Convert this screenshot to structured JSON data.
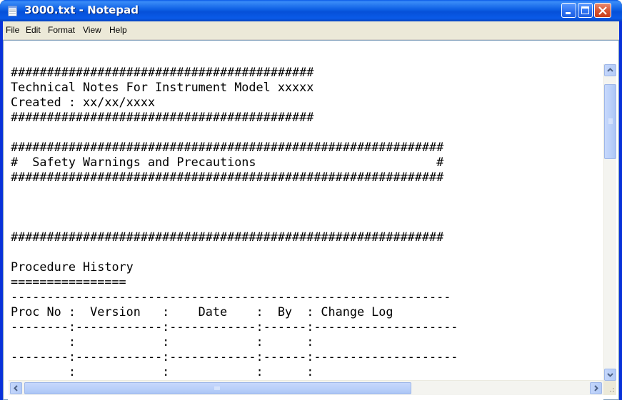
{
  "window": {
    "title": "3000.txt - Notepad"
  },
  "menu": {
    "items": [
      "File",
      "Edit",
      "Format",
      "View",
      "Help"
    ]
  },
  "document": {
    "lines": [
      "##########################################",
      "Technical Notes For Instrument Model xxxxx",
      "Created : xx/xx/xxxx",
      "##########################################",
      "",
      "############################################################",
      "#  Safety Warnings and Precautions                         #",
      "############################################################",
      "",
      "",
      "",
      "############################################################",
      "",
      "Procedure History",
      "================",
      "-------------------------------------------------------------",
      "Proc No :  Version   :    Date    :  By  : Change Log",
      "--------:------------:------------:------:--------------------",
      "        :            :            :      :",
      "--------:------------:------------:------:--------------------",
      "        :            :            :      :"
    ]
  },
  "icons": {
    "app": "notepad-icon",
    "minimize": "minimize-icon",
    "maximize": "maximize-icon",
    "close": "close-icon",
    "scroll_up": "chevron-up-icon",
    "scroll_down": "chevron-down-icon",
    "scroll_left": "chevron-left-icon",
    "scroll_right": "chevron-right-icon"
  },
  "colors": {
    "titlebar": "#0a5ae8",
    "menubar": "#ece9d8",
    "close_button": "#d8532f"
  }
}
